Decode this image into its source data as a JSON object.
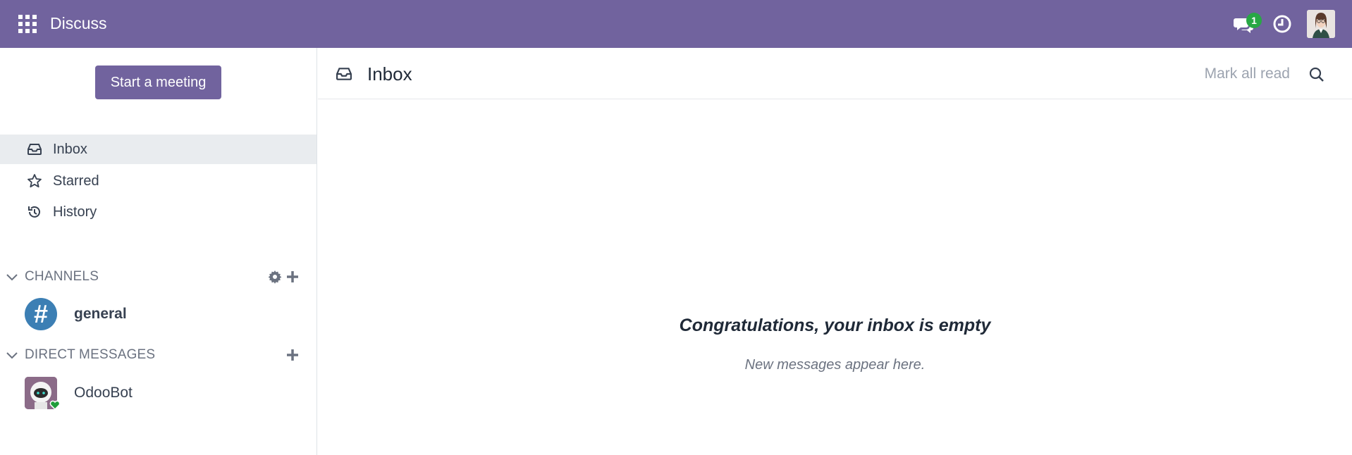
{
  "navbar": {
    "app_title": "Discuss",
    "apps_icon": "grid-icon",
    "messages_badge": "1",
    "accent_color": "#71639e",
    "badge_color": "#28a745"
  },
  "sidebar": {
    "start_meeting_label": "Start a meeting",
    "mailboxes": [
      {
        "label": "Inbox",
        "icon": "inbox-icon",
        "active": true
      },
      {
        "label": "Starred",
        "icon": "star-icon",
        "active": false
      },
      {
        "label": "History",
        "icon": "history-icon",
        "active": false
      }
    ],
    "channels": {
      "header": "CHANNELS",
      "items": [
        {
          "name": "general",
          "avatar_glyph": "#",
          "avatar_color": "#3c7fb4"
        }
      ]
    },
    "direct_messages": {
      "header": "DIRECT MESSAGES",
      "items": [
        {
          "name": "OdooBot",
          "presence": "online"
        }
      ]
    }
  },
  "main": {
    "title": "Inbox",
    "mark_all_read_label": "Mark all read",
    "empty_title": "Congratulations, your inbox is empty",
    "empty_subtitle": "New messages appear here."
  }
}
